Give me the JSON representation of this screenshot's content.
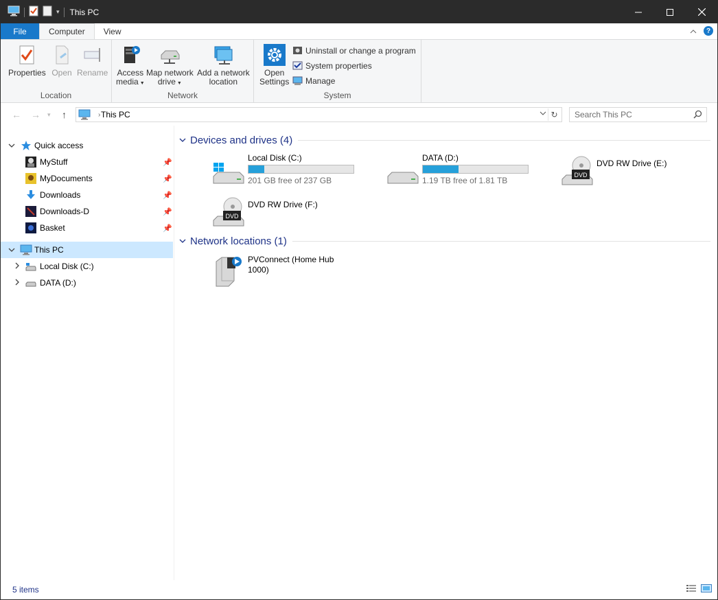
{
  "window": {
    "title": "This PC"
  },
  "ribbon_tabs": [
    "File",
    "Computer",
    "View"
  ],
  "ribbon": {
    "location": {
      "label": "Location",
      "properties": "Properties",
      "open": "Open",
      "rename": "Rename"
    },
    "network": {
      "label": "Network",
      "access_media_1": "Access",
      "access_media_2": "media",
      "map_drive_1": "Map network",
      "map_drive_2": "drive",
      "add_location_1": "Add a network",
      "add_location_2": "location"
    },
    "system": {
      "label": "System",
      "open_settings_1": "Open",
      "open_settings_2": "Settings",
      "uninstall": "Uninstall or change a program",
      "system_properties": "System properties",
      "manage": "Manage"
    }
  },
  "address": {
    "crumb": "This PC",
    "search_placeholder": "Search This PC"
  },
  "nav_pane": {
    "quick_access": "Quick access",
    "quick_items": [
      "MyStuff",
      "MyDocuments",
      "Downloads",
      "Downloads-D",
      "Basket"
    ],
    "this_pc": "This PC",
    "drives": [
      "Local Disk (C:)",
      "DATA (D:)"
    ]
  },
  "content": {
    "devices_header": "Devices and drives (4)",
    "network_header": "Network locations (1)",
    "devices": [
      {
        "name": "Local Disk (C:)",
        "free": "201 GB free of 237 GB",
        "used_fraction": 0.15
      },
      {
        "name": "DATA (D:)",
        "free": "1.19 TB free of 1.81 TB",
        "used_fraction": 0.34
      },
      {
        "name": "DVD RW Drive (E:)"
      },
      {
        "name": "DVD RW Drive (F:)"
      }
    ],
    "network": [
      {
        "name_line1": "PVConnect (Home Hub",
        "name_line2": "1000)"
      }
    ]
  },
  "status": {
    "count": "5 items"
  },
  "colors": {
    "accent": "#1979ca",
    "bar_fill": "#26a0da",
    "selection": "#cce8ff",
    "group_header": "#1e3287"
  }
}
